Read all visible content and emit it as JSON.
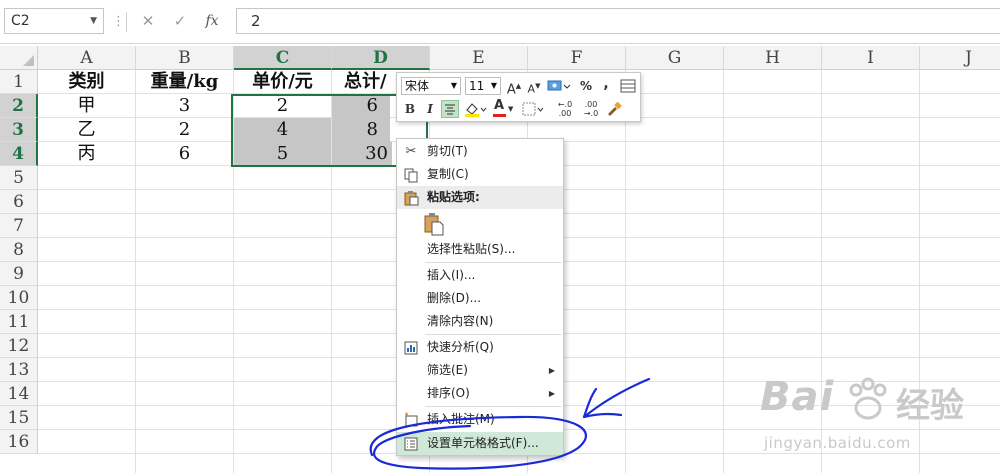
{
  "formula_bar": {
    "name_box": "C2",
    "cancel_icon": "✕",
    "enter_icon": "✓",
    "fx_label": "fx",
    "value": "2"
  },
  "columns": [
    "A",
    "B",
    "C",
    "D",
    "E",
    "F",
    "G",
    "H",
    "I",
    "J"
  ],
  "selected_columns": [
    "C",
    "D"
  ],
  "rows": [
    "1",
    "2",
    "3",
    "4",
    "5",
    "6",
    "7",
    "8",
    "9",
    "10",
    "11",
    "12",
    "13",
    "14",
    "15",
    "16"
  ],
  "selected_rows": [
    "2",
    "3",
    "4"
  ],
  "cells": {
    "A1": "类别",
    "B1": "重量/kg",
    "C1": "单价/元",
    "D1": "总计/",
    "A2": "甲",
    "B2": "3",
    "C2": "2",
    "D2": "6",
    "A3": "乙",
    "B3": "2",
    "C3": "4",
    "D3": "8",
    "A4": "丙",
    "B4": "6",
    "C4": "5",
    "D4": "30"
  },
  "mini_toolbar": {
    "font_name": "宋体",
    "font_size": "11",
    "grow_font": "A",
    "shrink_font": "A",
    "percent": "%",
    "comma": ",",
    "bold": "B",
    "italic": "I",
    "font_color_letter": "A",
    "inc_decimal": "←.0 .00",
    "dec_decimal": ".00 →.0"
  },
  "context_menu": {
    "items": [
      {
        "label": "剪切(T)",
        "icon": "scissors-icon"
      },
      {
        "label": "复制(C)",
        "icon": "copy-icon"
      },
      {
        "label": "粘贴选项:",
        "icon": "paste-icon"
      },
      {
        "label": "选择性粘贴(S)..."
      },
      {
        "label": "插入(I)..."
      },
      {
        "label": "删除(D)..."
      },
      {
        "label": "清除内容(N)"
      },
      {
        "label": "快速分析(Q)",
        "icon": "quick-analysis-icon"
      },
      {
        "label": "筛选(E)"
      },
      {
        "label": "排序(O)"
      },
      {
        "label": "插入批注(M)",
        "icon": "new-comment-icon"
      },
      {
        "label": "设置单元格格式(F)...",
        "icon": "format-cells-icon"
      }
    ],
    "highlighted": "设置单元格格式(F)..."
  },
  "colors": {
    "selection_green": "#217346",
    "selected_cell_bg": "#c6c6c6",
    "highlight": "#d0e8d8",
    "annotation_ink": "#1a2bd6",
    "font_color_bar": "#e02020",
    "fill_color_bar": "#ffe600"
  },
  "watermark": {
    "brand_top": "Bai",
    "brand_cn": "经验",
    "url": "jingyan.baidu.com"
  }
}
